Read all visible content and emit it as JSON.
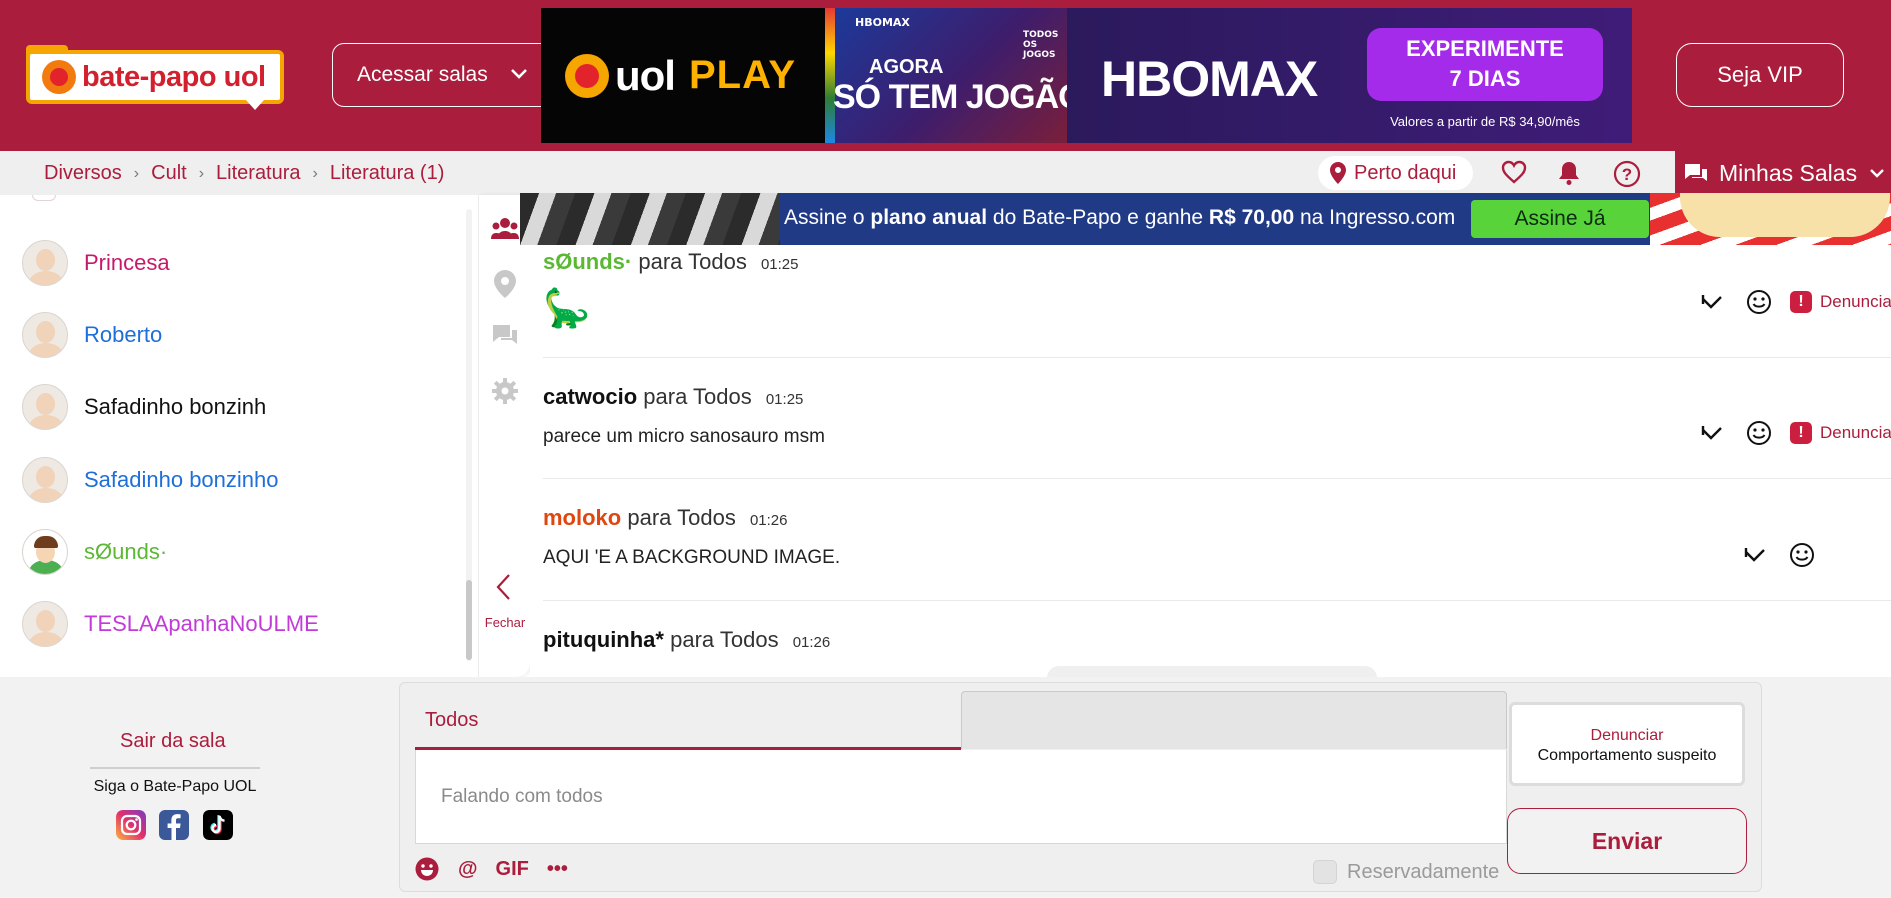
{
  "header": {
    "logo_text": "bate-papo uol",
    "rooms_button": "Acessar salas",
    "vip_button": "Seja VIP",
    "ad": {
      "uol": "uol",
      "play": "PLAY",
      "hbomax_mini": "HBOMAX",
      "todos_mini": "TODOS OS JOGOS",
      "agora": "AGORA",
      "so_tem_jogao": "SÓ TEM JOGÃO!",
      "hbomax": "HBOMAX",
      "cta_line1": "EXPERIMENTE",
      "cta_line2": "7 DIAS",
      "price_note": "Valores a partir de R$ 34,90/mês"
    }
  },
  "subnav": {
    "breadcrumbs": [
      "Diversos",
      "Cult",
      "Literatura",
      "Literatura (1)"
    ],
    "nearby": "Perto daqui",
    "my_rooms": "Minhas Salas"
  },
  "users": [
    {
      "name": "Princesa",
      "color": "#c7196b"
    },
    {
      "name": "Roberto",
      "color": "#1e6fd9"
    },
    {
      "name": "Safadinho bonzinh",
      "color": "#111111"
    },
    {
      "name": "Safadinho bonzinho",
      "color": "#1e6fd9"
    },
    {
      "name": "sØunds·",
      "color": "#5bb832"
    },
    {
      "name": "TESLAApanhaNoULME",
      "color": "#c23ad9"
    }
  ],
  "rail": {
    "close_label": "Fechar"
  },
  "promo": {
    "text_a": "Assine o ",
    "text_b": "plano anual",
    "text_c": " do Bate-Papo e ganhe ",
    "text_d": "R$ 70,00",
    "text_e": " na Ingresso.com",
    "cta": "Assine Já"
  },
  "messages": [
    {
      "from": "sØunds·",
      "to": "para Todos",
      "time": "01:25",
      "body": "🦕",
      "from_color": "#5bb832",
      "report": "Denunciar"
    },
    {
      "from": "catwocio",
      "to": "para Todos",
      "time": "01:25",
      "body": "parece um micro sanosauro msm",
      "from_color": "#111111",
      "report": "Denunciar"
    },
    {
      "from": "moloko",
      "to": "para Todos",
      "time": "01:26",
      "body": "AQUI 'E A BACKGROUND IMAGE.",
      "from_color": "#e0460f"
    },
    {
      "from": "pituquinha*",
      "to": "para Todos",
      "time": "01:26",
      "body": "",
      "from_color": "#111111"
    }
  ],
  "bottom": {
    "leave_room": "Sair da sala",
    "follow": "Siga o Bate-Papo UOL",
    "tab_all": "Todos",
    "input_placeholder": "Falando com todos",
    "gif": "GIF",
    "at": "@",
    "more": "•••",
    "private": "Reservadamente",
    "report_line1": "Denunciar",
    "report_line2": "Comportamento suspeito",
    "send": "Enviar"
  },
  "colors": {
    "brand": "#ab1d3c",
    "promo_bg": "#213a86",
    "cta_green": "#58d43a",
    "hbo_purple": "#a42bea"
  },
  "icons": [
    "chevron-down-icon",
    "location-pin-icon",
    "heart-icon",
    "bell-icon",
    "help-icon",
    "chat-bubbles-icon",
    "users-icon",
    "settings-icon",
    "chevron-left-icon",
    "reply-icon",
    "emoji-icon",
    "alert-icon",
    "instagram-icon",
    "facebook-icon",
    "tiktok-icon"
  ]
}
